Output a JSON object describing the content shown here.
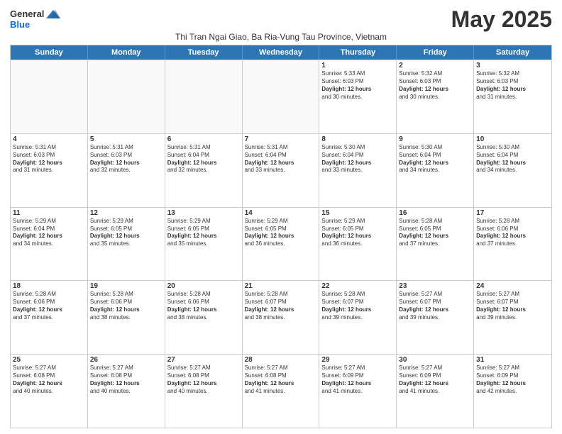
{
  "logo": {
    "general": "General",
    "blue": "Blue"
  },
  "title": "May 2025",
  "subtitle": "Thi Tran Ngai Giao, Ba Ria-Vung Tau Province, Vietnam",
  "days": [
    "Sunday",
    "Monday",
    "Tuesday",
    "Wednesday",
    "Thursday",
    "Friday",
    "Saturday"
  ],
  "weeks": [
    [
      {
        "day": "",
        "content": ""
      },
      {
        "day": "",
        "content": ""
      },
      {
        "day": "",
        "content": ""
      },
      {
        "day": "",
        "content": ""
      },
      {
        "day": "1",
        "content": "Sunrise: 5:33 AM\nSunset: 6:03 PM\nDaylight: 12 hours\nand 30 minutes."
      },
      {
        "day": "2",
        "content": "Sunrise: 5:32 AM\nSunset: 6:03 PM\nDaylight: 12 hours\nand 30 minutes."
      },
      {
        "day": "3",
        "content": "Sunrise: 5:32 AM\nSunset: 6:03 PM\nDaylight: 12 hours\nand 31 minutes."
      }
    ],
    [
      {
        "day": "4",
        "content": "Sunrise: 5:31 AM\nSunset: 6:03 PM\nDaylight: 12 hours\nand 31 minutes."
      },
      {
        "day": "5",
        "content": "Sunrise: 5:31 AM\nSunset: 6:03 PM\nDaylight: 12 hours\nand 32 minutes."
      },
      {
        "day": "6",
        "content": "Sunrise: 5:31 AM\nSunset: 6:04 PM\nDaylight: 12 hours\nand 32 minutes."
      },
      {
        "day": "7",
        "content": "Sunrise: 5:31 AM\nSunset: 6:04 PM\nDaylight: 12 hours\nand 33 minutes."
      },
      {
        "day": "8",
        "content": "Sunrise: 5:30 AM\nSunset: 6:04 PM\nDaylight: 12 hours\nand 33 minutes."
      },
      {
        "day": "9",
        "content": "Sunrise: 5:30 AM\nSunset: 6:04 PM\nDaylight: 12 hours\nand 34 minutes."
      },
      {
        "day": "10",
        "content": "Sunrise: 5:30 AM\nSunset: 6:04 PM\nDaylight: 12 hours\nand 34 minutes."
      }
    ],
    [
      {
        "day": "11",
        "content": "Sunrise: 5:29 AM\nSunset: 6:04 PM\nDaylight: 12 hours\nand 34 minutes."
      },
      {
        "day": "12",
        "content": "Sunrise: 5:29 AM\nSunset: 6:05 PM\nDaylight: 12 hours\nand 35 minutes."
      },
      {
        "day": "13",
        "content": "Sunrise: 5:29 AM\nSunset: 6:05 PM\nDaylight: 12 hours\nand 35 minutes."
      },
      {
        "day": "14",
        "content": "Sunrise: 5:29 AM\nSunset: 6:05 PM\nDaylight: 12 hours\nand 36 minutes."
      },
      {
        "day": "15",
        "content": "Sunrise: 5:29 AM\nSunset: 6:05 PM\nDaylight: 12 hours\nand 36 minutes."
      },
      {
        "day": "16",
        "content": "Sunrise: 5:28 AM\nSunset: 6:05 PM\nDaylight: 12 hours\nand 37 minutes."
      },
      {
        "day": "17",
        "content": "Sunrise: 5:28 AM\nSunset: 6:06 PM\nDaylight: 12 hours\nand 37 minutes."
      }
    ],
    [
      {
        "day": "18",
        "content": "Sunrise: 5:28 AM\nSunset: 6:06 PM\nDaylight: 12 hours\nand 37 minutes."
      },
      {
        "day": "19",
        "content": "Sunrise: 5:28 AM\nSunset: 6:06 PM\nDaylight: 12 hours\nand 38 minutes."
      },
      {
        "day": "20",
        "content": "Sunrise: 5:28 AM\nSunset: 6:06 PM\nDaylight: 12 hours\nand 38 minutes."
      },
      {
        "day": "21",
        "content": "Sunrise: 5:28 AM\nSunset: 6:07 PM\nDaylight: 12 hours\nand 38 minutes."
      },
      {
        "day": "22",
        "content": "Sunrise: 5:28 AM\nSunset: 6:07 PM\nDaylight: 12 hours\nand 39 minutes."
      },
      {
        "day": "23",
        "content": "Sunrise: 5:27 AM\nSunset: 6:07 PM\nDaylight: 12 hours\nand 39 minutes."
      },
      {
        "day": "24",
        "content": "Sunrise: 5:27 AM\nSunset: 6:07 PM\nDaylight: 12 hours\nand 39 minutes."
      }
    ],
    [
      {
        "day": "25",
        "content": "Sunrise: 5:27 AM\nSunset: 6:08 PM\nDaylight: 12 hours\nand 40 minutes."
      },
      {
        "day": "26",
        "content": "Sunrise: 5:27 AM\nSunset: 6:08 PM\nDaylight: 12 hours\nand 40 minutes."
      },
      {
        "day": "27",
        "content": "Sunrise: 5:27 AM\nSunset: 6:08 PM\nDaylight: 12 hours\nand 40 minutes."
      },
      {
        "day": "28",
        "content": "Sunrise: 5:27 AM\nSunset: 6:08 PM\nDaylight: 12 hours\nand 41 minutes."
      },
      {
        "day": "29",
        "content": "Sunrise: 5:27 AM\nSunset: 6:09 PM\nDaylight: 12 hours\nand 41 minutes."
      },
      {
        "day": "30",
        "content": "Sunrise: 5:27 AM\nSunset: 6:09 PM\nDaylight: 12 hours\nand 41 minutes."
      },
      {
        "day": "31",
        "content": "Sunrise: 5:27 AM\nSunset: 6:09 PM\nDaylight: 12 hours\nand 42 minutes."
      }
    ]
  ]
}
